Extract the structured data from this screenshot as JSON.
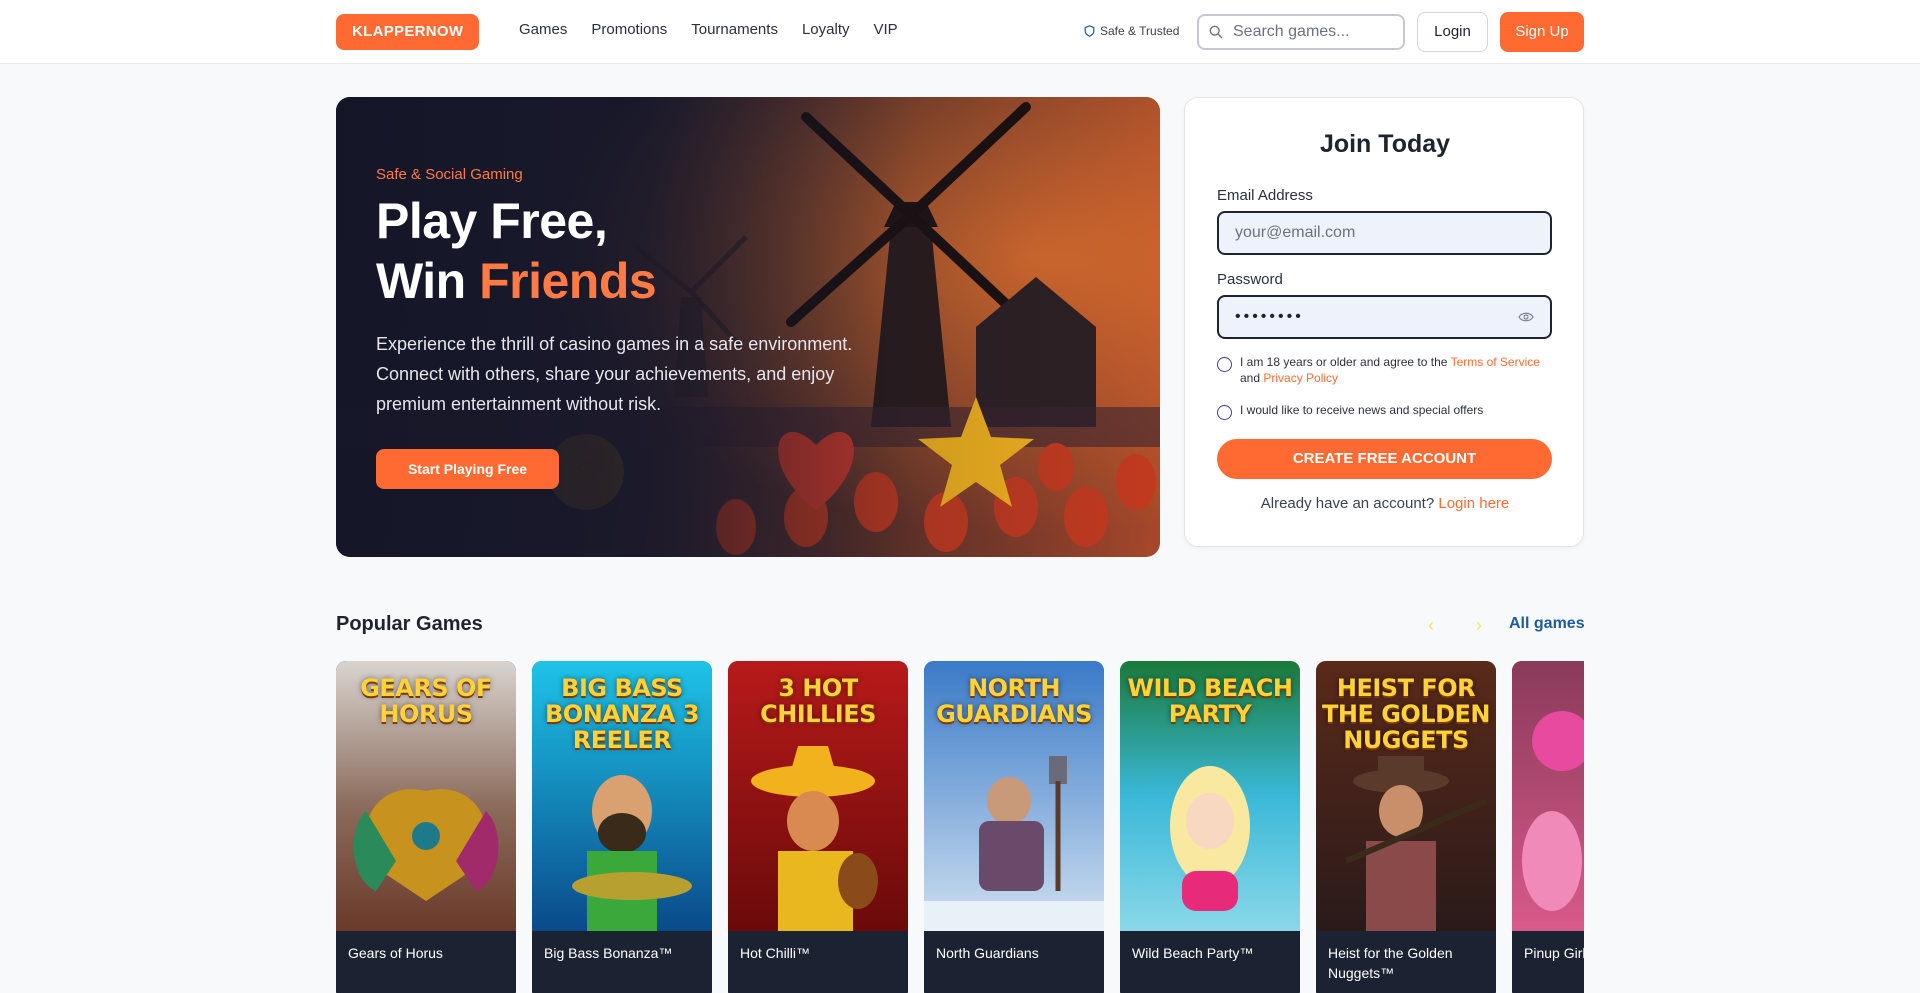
{
  "nav": {
    "logo": "KLAPPERNOW",
    "links": [
      "Games",
      "Promotions",
      "Tournaments",
      "Loyalty",
      "VIP"
    ],
    "trusted": "Safe & Trusted",
    "search_placeholder": "Search games...",
    "login": "Login",
    "signup": "Sign Up"
  },
  "hero": {
    "eyebrow": "Safe & Social Gaming",
    "title_line1": "Play Free,",
    "title_line2_a": "Win ",
    "title_line2_b": "Friends",
    "description": "Experience the thrill of casino games in a safe environment. Connect with others, share your achievements, and enjoy premium entertainment without risk.",
    "cta": "Start Playing Free"
  },
  "join": {
    "title": "Join Today",
    "email_label": "Email Address",
    "email_placeholder": "your@email.com",
    "password_label": "Password",
    "password_mask": "••••••••",
    "terms_prefix": "I am 18 years or older and agree to the ",
    "terms_link": "Terms of Service",
    "terms_and": " and ",
    "privacy_link": "Privacy Policy",
    "newsletter": "I would like to receive news and special offers",
    "create_button": "CREATE FREE ACCOUNT",
    "already_prefix": "Already have an account? ",
    "login_link": "Login here"
  },
  "popular": {
    "title": "Popular Games",
    "prev_icon": "‹",
    "next_icon": "›",
    "all_games": "All games",
    "games": [
      {
        "name": "Gears of Horus",
        "art": "GEARS OF HORUS"
      },
      {
        "name": "Big Bass Bonanza™",
        "art": "BIG BASS BONANZA 3 REELER"
      },
      {
        "name": "Hot Chilli™",
        "art": "3 HOT CHILLIES"
      },
      {
        "name": "North Guardians",
        "art": "NORTH GUARDIANS"
      },
      {
        "name": "Wild Beach Party™",
        "art": "WILD BEACH PARTY"
      },
      {
        "name": "Heist for the Golden Nuggets™",
        "art": "HEIST FOR THE GOLDEN NUGGETS"
      },
      {
        "name": "Pinup Girls",
        "art": ""
      }
    ]
  },
  "colors": {
    "accent": "#ff6a33",
    "link_blue": "#1f5a9e",
    "dark": "#1e2330"
  }
}
